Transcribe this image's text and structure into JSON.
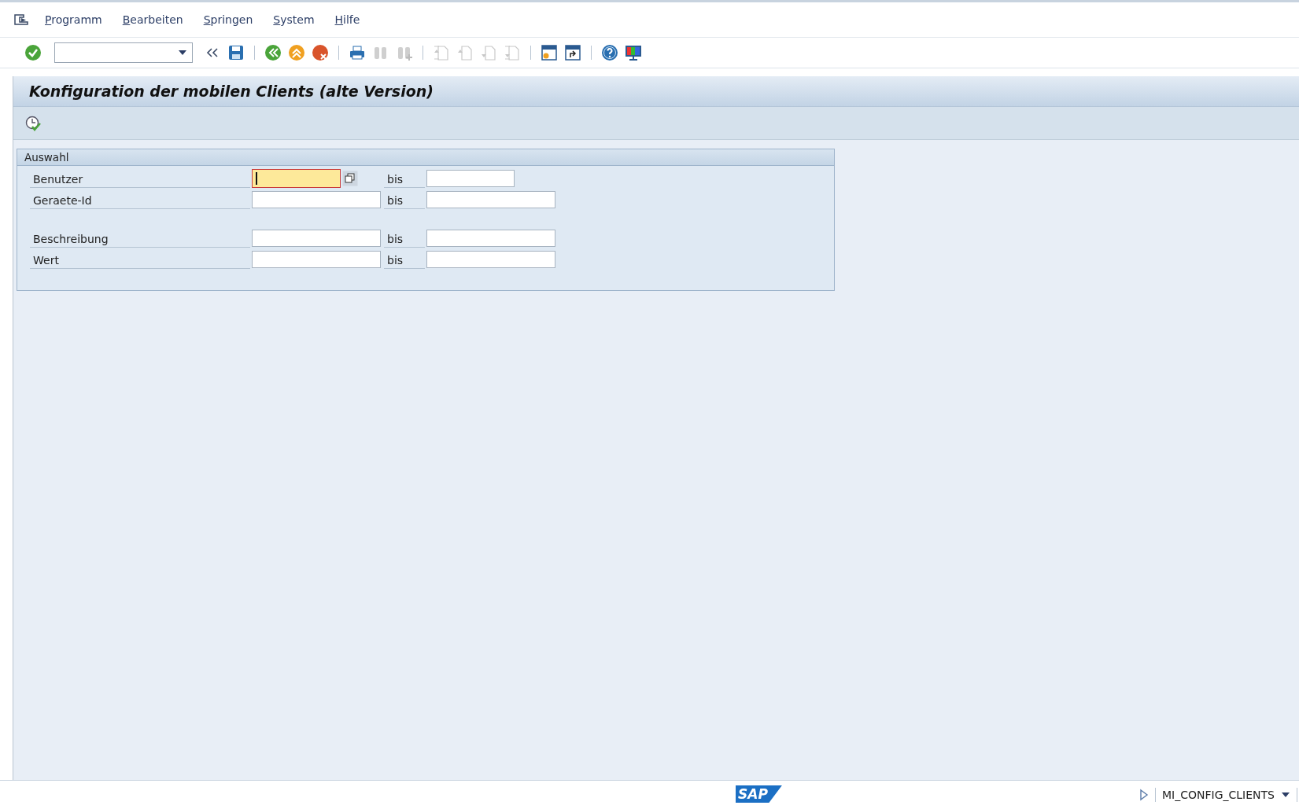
{
  "menu_bar": {
    "items": [
      {
        "label": "Programm"
      },
      {
        "label": "Bearbeiten"
      },
      {
        "label": "Springen"
      },
      {
        "label": "System"
      },
      {
        "label": "Hilfe"
      }
    ]
  },
  "toolbar": {
    "items": [
      {
        "kind": "enter",
        "disabled": false
      },
      {
        "kind": "command_field"
      },
      {
        "kind": "collapse",
        "disabled": false
      },
      {
        "kind": "save",
        "disabled": false
      },
      {
        "kind": "separator"
      },
      {
        "kind": "back",
        "disabled": false
      },
      {
        "kind": "exit",
        "disabled": false
      },
      {
        "kind": "cancel",
        "disabled": false
      },
      {
        "kind": "separator"
      },
      {
        "kind": "print",
        "disabled": false
      },
      {
        "kind": "find",
        "disabled": true
      },
      {
        "kind": "find_next",
        "disabled": true
      },
      {
        "kind": "separator"
      },
      {
        "kind": "first_page",
        "disabled": true
      },
      {
        "kind": "previous_page",
        "disabled": true
      },
      {
        "kind": "next_page",
        "disabled": true
      },
      {
        "kind": "last_page",
        "disabled": true
      },
      {
        "kind": "separator"
      },
      {
        "kind": "new_session",
        "disabled": false
      },
      {
        "kind": "shortcut",
        "disabled": false
      },
      {
        "kind": "separator"
      },
      {
        "kind": "help",
        "disabled": false
      },
      {
        "kind": "customize",
        "disabled": false
      }
    ]
  },
  "title": "Konfiguration der mobilen Clients (alte Version)",
  "application_toolbar": {
    "items": [
      {
        "kind": "execute"
      }
    ]
  },
  "selection_group": {
    "title": "Auswahl",
    "blocks": [
      {
        "rows": [
          {
            "label": "Benutzer",
            "range_label": "bis",
            "from_focused": true,
            "multiple_selection_button": true
          },
          {
            "label": "Geraete-Id",
            "range_label": "bis",
            "from_focused": false,
            "multiple_selection_button": false
          }
        ]
      },
      {
        "rows": [
          {
            "label": "Beschreibung",
            "range_label": "bis",
            "from_focused": false,
            "multiple_selection_button": false
          },
          {
            "label": "Wert",
            "range_label": "bis",
            "from_focused": false,
            "multiple_selection_button": false
          }
        ]
      }
    ]
  },
  "status_bar": {
    "logo": "SAP",
    "transaction": "MI_CONFIG_CLIENTS"
  }
}
